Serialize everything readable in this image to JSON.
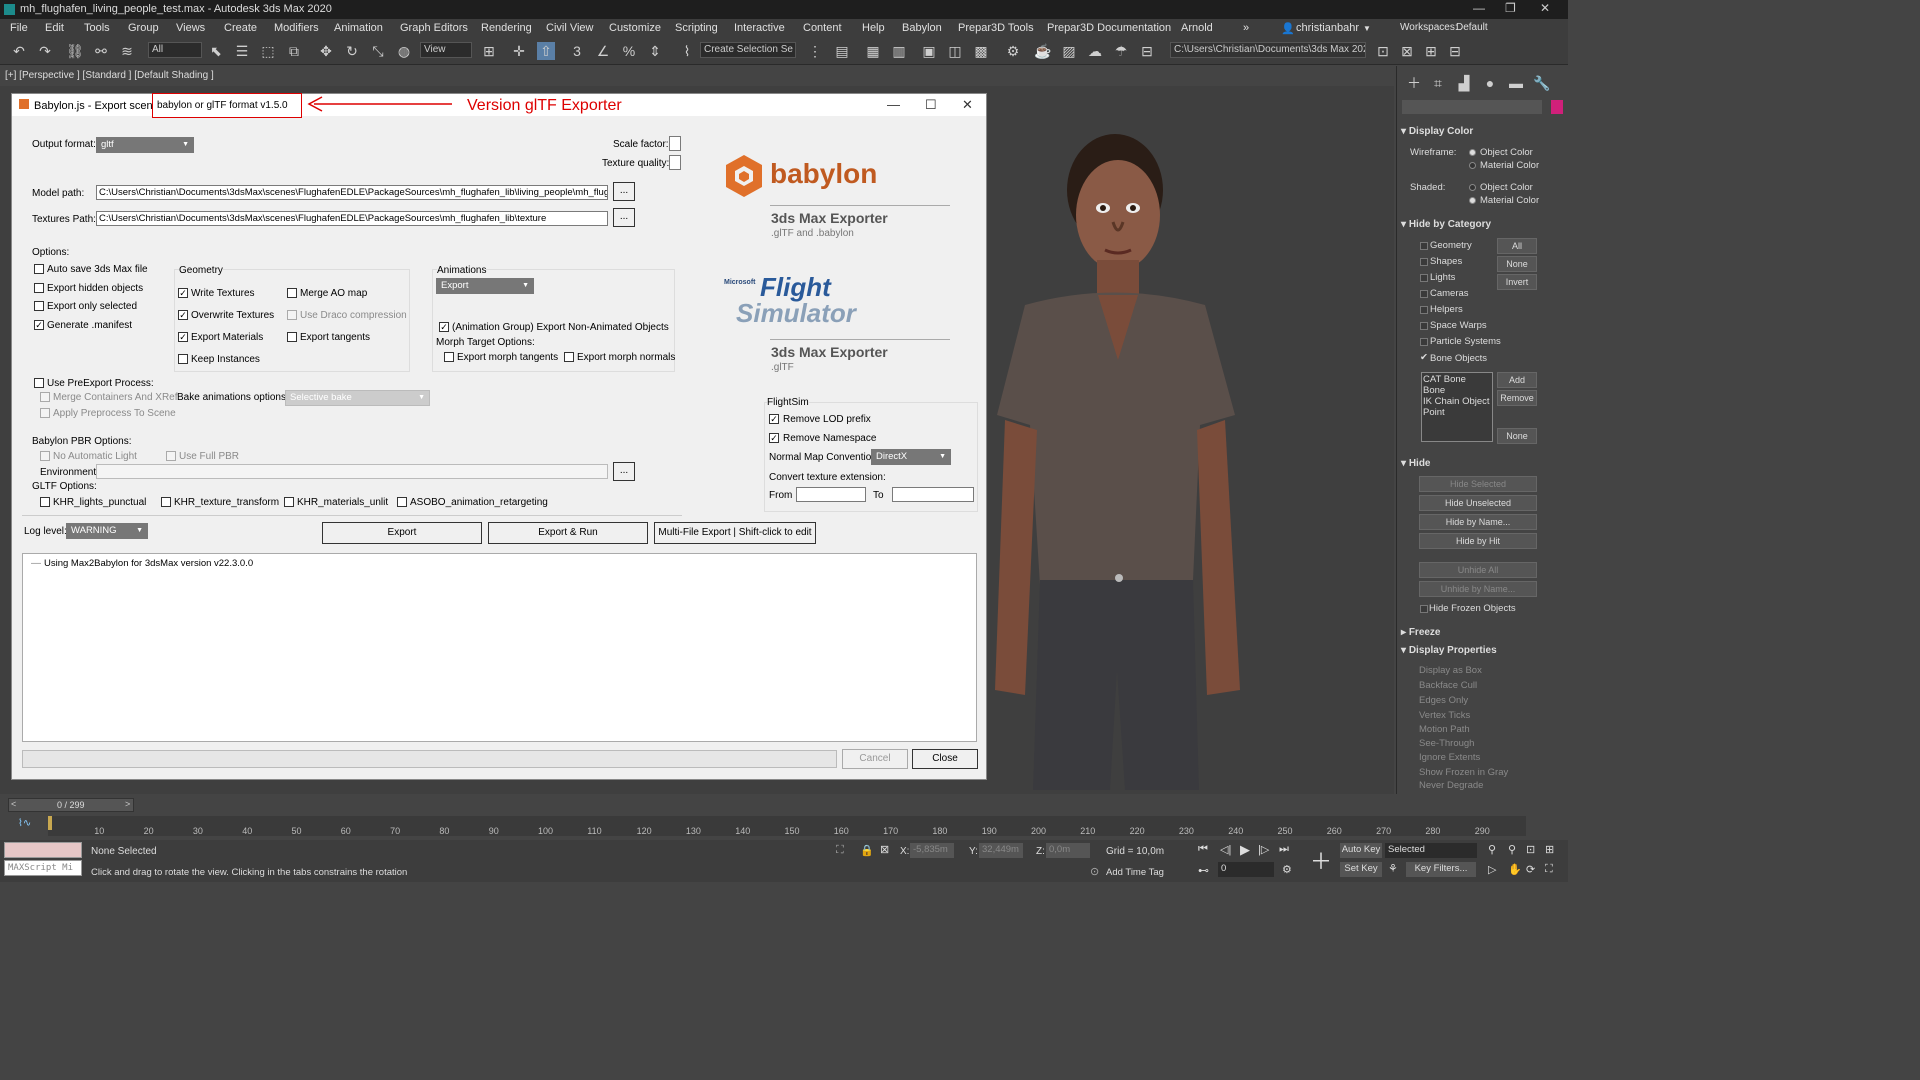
{
  "app": {
    "window_title": "mh_flughafen_living_people_test.max - Autodesk 3ds Max 2020",
    "window_controls": [
      "—",
      "❐",
      "✕"
    ]
  },
  "menu": [
    "File",
    "Edit",
    "Tools",
    "Group",
    "Views",
    "Create",
    "Modifiers",
    "Animation",
    "Graph Editors",
    "Rendering",
    "Civil View",
    "Customize",
    "Scripting",
    "Interactive",
    "Content",
    "Help",
    "Babylon",
    "Prepar3D Tools",
    "Prepar3D Documentation",
    "Arnold",
    "»"
  ],
  "user": {
    "name": "christianbahr",
    "workspaces_label": "Workspaces:",
    "workspaces_value": "Default"
  },
  "toolbar": {
    "selection_filter": "All",
    "ref_coord": "View",
    "create_selection_set": "Create Selection Se",
    "project_path": "C:\\Users\\Christian\\Documents\\3ds Max 2020"
  },
  "viewport": {
    "label": "[+] [Perspective ] [Standard ] [Default Shading ]"
  },
  "annotation": {
    "box_text": "babylon or glTF format v1.5.0",
    "label": "Version glTF Exporter"
  },
  "dialog": {
    "title": "Babylon.js - Export scene to",
    "output_format_label": "Output format:",
    "output_format_value": "gltf",
    "scale_factor_label": "Scale factor:",
    "texture_quality_label": "Texture quality:",
    "model_path_label": "Model path:",
    "model_path_value": "C:\\Users\\Christian\\Documents\\3dsMax\\scenes\\FlughafenEDLE\\PackageSources\\mh_flughafen_lib\\living_people\\mh_flughafen_l",
    "textures_path_label": "Textures Path:",
    "textures_path_value": "C:\\Users\\Christian\\Documents\\3dsMax\\scenes\\FlughafenEDLE\\PackageSources\\mh_flughafen_lib\\texture",
    "browse_label": "...",
    "options_label": "Options:",
    "options": [
      {
        "label": "Auto save 3ds Max file",
        "checked": false
      },
      {
        "label": "Export hidden objects",
        "checked": false
      },
      {
        "label": "Export only selected",
        "checked": false
      },
      {
        "label": "Generate .manifest",
        "checked": true
      }
    ],
    "geometry_label": "Geometry",
    "geometry_options": [
      {
        "label": "Write Textures",
        "checked": true
      },
      {
        "label": "Overwrite Textures",
        "checked": true
      },
      {
        "label": "Export Materials",
        "checked": true
      },
      {
        "label": "Keep Instances",
        "checked": false
      },
      {
        "label": "Merge AO map",
        "checked": false
      },
      {
        "label": "Use Draco compression",
        "checked": false,
        "disabled": true
      },
      {
        "label": "Export tangents",
        "checked": false
      }
    ],
    "animations_label": "Animations",
    "animations_value": "Export",
    "anim_group_label": "(Animation Group) Export Non-Animated Objects",
    "morph_label": "Morph Target Options:",
    "morph_tangents": "Export morph tangents",
    "morph_normals": "Export morph normals",
    "preexport_label": "Use PreExport Process:",
    "merge_containers": "Merge Containers And XRef",
    "apply_preprocess": "Apply Preprocess To Scene",
    "bake_label": "Bake animations options:",
    "bake_value": "Selective bake",
    "pbr_label": "Babylon PBR Options:",
    "no_auto_light": "No Automatic Light",
    "use_full_pbr": "Use Full PBR",
    "environment_label": "Environment",
    "gltf_options_label": "GLTF Options:",
    "gltf_options": [
      "KHR_lights_punctual",
      "KHR_texture_transform",
      "KHR_materials_unlit",
      "ASOBO_animation_retargeting"
    ],
    "log_level_label": "Log level:",
    "log_level_value": "WARNING",
    "export_btn": "Export",
    "export_run_btn": "Export & Run",
    "multi_export_btn": "Multi-File Export | Shift-click to edit",
    "log_line": "Using Max2Babylon for 3dsMax version v22.3.0.0",
    "cancel_btn": "Cancel",
    "close_btn": "Close",
    "brand_babylon": "babylon",
    "brand1_title": "3ds Max Exporter",
    "brand1_sub": ".glTF and .babylon",
    "flight_top": "Microsoft",
    "flight_word1": "Flight",
    "flight_word2": "Simulator",
    "brand2_title": "3ds Max Exporter",
    "brand2_sub": ".glTF",
    "flightsim_label": "FlightSim",
    "remove_lod": "Remove LOD prefix",
    "remove_ns": "Remove Namespace",
    "normal_map_label": "Normal Map Convention",
    "normal_map_value": "DirectX",
    "convert_tex_label": "Convert texture extension:",
    "from_label": "From",
    "to_label": "To"
  },
  "cmd_panel": {
    "display_color": "Display Color",
    "wireframe": "Wireframe:",
    "shaded": "Shaded:",
    "object_color": "Object Color",
    "material_color": "Material Color",
    "hide_by_category": "Hide by Category",
    "categories": [
      "Geometry",
      "Shapes",
      "Lights",
      "Cameras",
      "Helpers",
      "Space Warps",
      "Particle Systems",
      "Bone Objects"
    ],
    "cat_buttons": [
      "All",
      "None",
      "Invert"
    ],
    "bone_list": [
      "CAT Bone",
      "Bone",
      "IK Chain Object",
      "Point"
    ],
    "list_buttons": [
      "Add",
      "Remove",
      "None"
    ],
    "hide": "Hide",
    "hide_buttons": [
      "Hide Selected",
      "Hide Unselected",
      "Hide by Name...",
      "Hide by Hit",
      "Unhide All",
      "Unhide by Name..."
    ],
    "hide_frozen": "Hide Frozen Objects",
    "freeze": "Freeze",
    "display_properties": "Display Properties",
    "display_props": [
      "Display as Box",
      "Backface Cull",
      "Edges Only",
      "Vertex Ticks",
      "Motion Path",
      "See-Through",
      "Ignore Extents",
      "Show Frozen in Gray",
      "Never Degrade"
    ]
  },
  "timeline": {
    "frame_display": "0 / 299",
    "ticks": [
      "10",
      "20",
      "30",
      "40",
      "50",
      "60",
      "70",
      "80",
      "90",
      "100",
      "110",
      "120",
      "130",
      "140",
      "150",
      "160",
      "170",
      "180",
      "190",
      "200",
      "210",
      "220",
      "230",
      "240",
      "250",
      "260",
      "270",
      "280",
      "290"
    ]
  },
  "status": {
    "maxscript": "MAXScript Mi",
    "selection": "None Selected",
    "prompt": "Click and drag to rotate the view.  Clicking in the tabs constrains the rotation",
    "x_label": "X:",
    "x_value": "-5,835m",
    "y_label": "Y:",
    "y_value": "32,449m",
    "z_label": "Z:",
    "z_value": "0,0m",
    "grid": "Grid = 10,0m",
    "add_time_tag": "Add Time Tag",
    "auto_key": "Auto Key",
    "set_key": "Set Key",
    "selected": "Selected",
    "key_filters": "Key Filters...",
    "frame_value": "0"
  },
  "colors": {
    "accent_red": "#dd0000",
    "babylon_orange": "#e0702a",
    "viewport_bg": "#3f3f3f"
  }
}
